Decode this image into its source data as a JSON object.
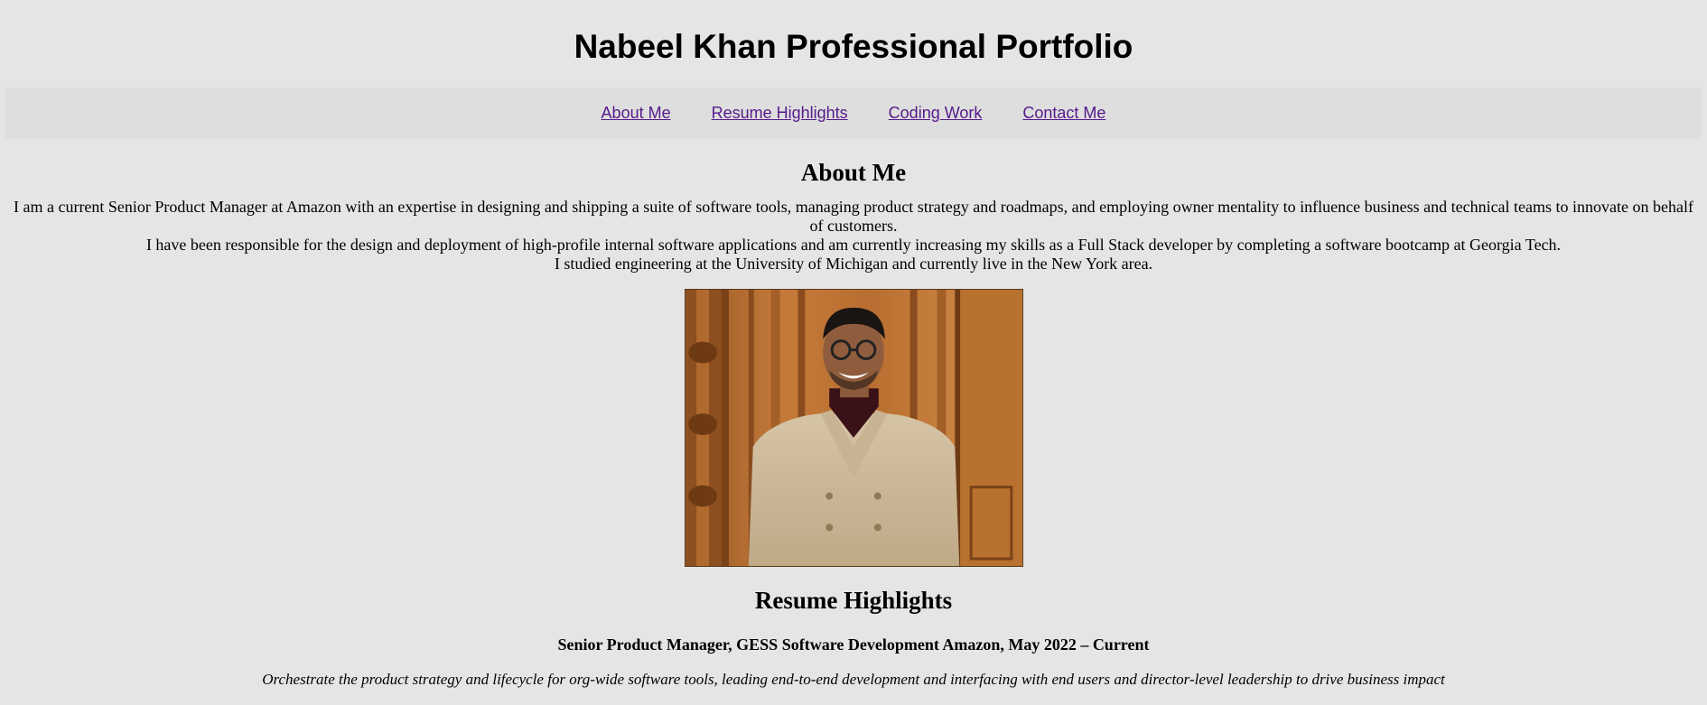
{
  "header": {
    "title": "Nabeel Khan Professional Portfolio"
  },
  "nav": {
    "items": [
      {
        "label": "About Me"
      },
      {
        "label": "Resume Highlights"
      },
      {
        "label": "Coding Work"
      },
      {
        "label": "Contact Me"
      }
    ],
    "link_color": "#551a8b"
  },
  "about": {
    "heading": "About Me",
    "paragraphs": [
      "I am a current Senior Product Manager at Amazon with an expertise in designing and shipping a suite of software tools, managing product strategy and roadmaps, and employing owner mentality to influence business and technical teams to innovate on behalf of customers.",
      "I have been responsible for the design and deployment of high-profile internal software applications and am currently increasing my skills as a Full Stack developer by completing a software bootcamp at Georgia Tech.",
      "I studied engineering at the University of Michigan and currently live in the New York area."
    ]
  },
  "resume": {
    "heading": "Resume Highlights",
    "jobs": [
      {
        "title": "Senior Product Manager, GESS Software Development Amazon, May 2022 – Current",
        "description": "Orchestrate the product strategy and lifecycle for org-wide software tools, leading end-to-end development and interfacing with end users and director-level leadership to drive business impact"
      }
    ]
  },
  "colors": {
    "background": "#e5e5e5",
    "nav_background": "#dedede"
  }
}
